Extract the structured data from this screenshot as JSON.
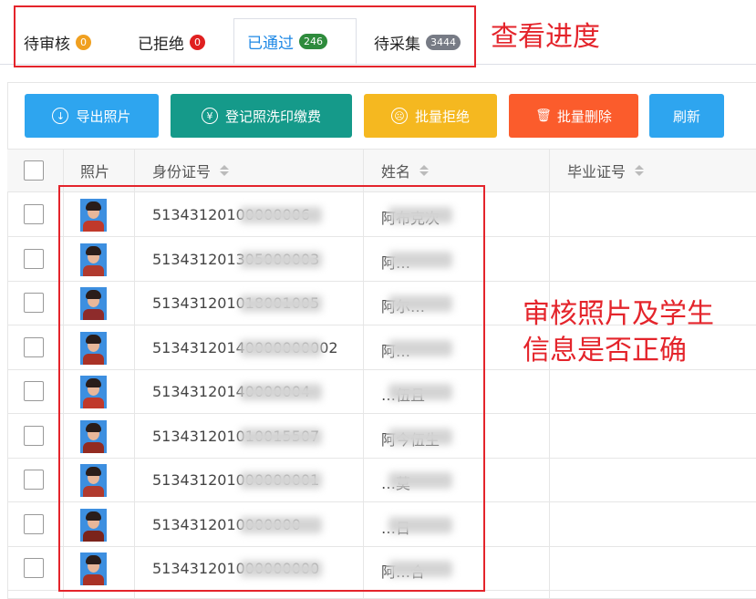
{
  "tabs": [
    {
      "label": "待审核",
      "count": "0",
      "color": "#f0a020"
    },
    {
      "label": "已拒绝",
      "count": "0",
      "color": "#e02020"
    },
    {
      "label": "已通过",
      "count": "246",
      "color": "#2e8b3c"
    },
    {
      "label": "待采集",
      "count": "3444",
      "color": "#777b85"
    }
  ],
  "annotations": {
    "progress": "查看进度",
    "check_line1": "审核照片及学生",
    "check_line2": "信息是否正确"
  },
  "toolbar": {
    "export": {
      "label": "导出照片",
      "icon": "download-icon",
      "color": "#2ea5ef"
    },
    "register": {
      "label": "登记照洗印缴费",
      "icon": "yen-icon",
      "color": "#159a8a"
    },
    "reject": {
      "label": "批量拒绝",
      "icon": "sad-face-icon",
      "color": "#f5b820"
    },
    "delete": {
      "label": "批量删除",
      "icon": "trash-icon",
      "color": "#fb5c2c"
    },
    "refresh": {
      "label": "刷新",
      "color": "#2ea5ef"
    }
  },
  "columns": {
    "photo": "照片",
    "id": "身份证号",
    "name": "姓名",
    "cert": "毕业证号"
  },
  "rows": [
    {
      "id": "51343120100000006",
      "name": "阿布克次"
    },
    {
      "id": "513431201305000003",
      "name": "阿…"
    },
    {
      "id": "513431201018001005",
      "name": "阿尔…"
    },
    {
      "id": "51343120140000000002",
      "name": "阿…"
    },
    {
      "id": "51343120140000004",
      "name": "…伍且"
    },
    {
      "id": "513431201010015507",
      "name": "阿今伍生"
    },
    {
      "id": "513431201000000001",
      "name": "…莫"
    },
    {
      "id": "5134312010000000",
      "name": "…日"
    },
    {
      "id": "513431201000000000",
      "name": "阿…合"
    }
  ]
}
